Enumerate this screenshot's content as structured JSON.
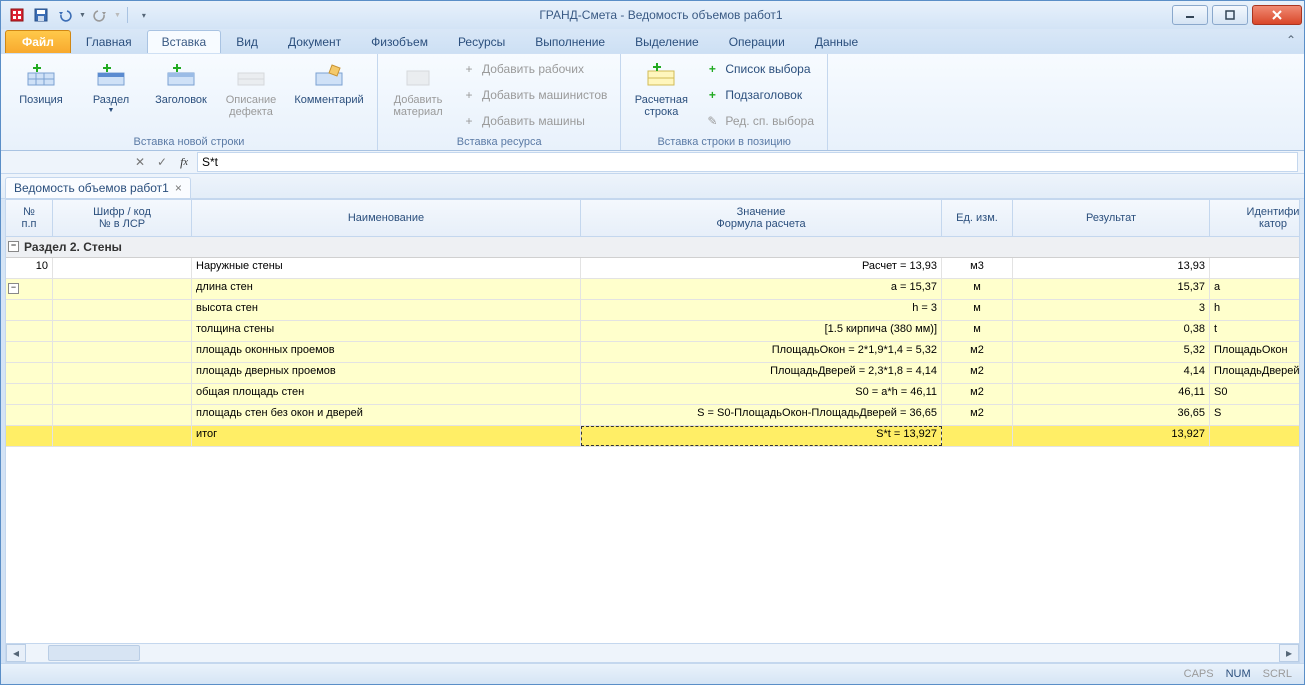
{
  "app_title": "ГРАНД-Смета - Ведомость объемов работ1",
  "tabs": {
    "file": "Файл",
    "items": [
      "Главная",
      "Вставка",
      "Вид",
      "Документ",
      "Физобъем",
      "Ресурсы",
      "Выполнение",
      "Выделение",
      "Операции",
      "Данные"
    ],
    "active": 1
  },
  "ribbon": {
    "g1": {
      "label": "Вставка новой строки",
      "position": "Позиция",
      "section": "Раздел",
      "header": "Заголовок",
      "defect": "Описание\nдефекта",
      "comment": "Комментарий"
    },
    "g2": {
      "label": "Вставка ресурса",
      "material": "Добавить\nматериал",
      "workers": "Добавить рабочих",
      "machinists": "Добавить машинистов",
      "machines": "Добавить машины"
    },
    "g3": {
      "label": "Вставка строки в позицию",
      "calcrow": "Расчетная\nстрока",
      "list": "Список выбора",
      "subhead": "Подзаголовок",
      "edit": "Ред. сп. выбора"
    }
  },
  "formula": {
    "value": "S*t"
  },
  "doc_tab": "Ведомость объемов работ1",
  "columns": {
    "np": "№\nп.п",
    "code": "Шифр / код\n№ в ЛСР",
    "name": "Наименование",
    "val": "Значение\nФормула расчета",
    "unit": "Ед. изм.",
    "res": "Результат",
    "id": "Идентифи\nкатор"
  },
  "section_title": "Раздел 2. Стены",
  "rows": [
    {
      "np": "10",
      "name": "Наружные стены",
      "val": "Расчет = 13,93",
      "unit": "м3",
      "res": "13,93",
      "ident": "",
      "variant": "plain"
    },
    {
      "np": "",
      "name": "длина стен",
      "val": "a = 15,37",
      "unit": "м",
      "res": "15,37",
      "ident": "a",
      "variant": "yellow"
    },
    {
      "np": "",
      "name": "высота стен",
      "val": "h = 3",
      "unit": "м",
      "res": "3",
      "ident": "h",
      "variant": "yellow"
    },
    {
      "np": "",
      "name": "толщина стены",
      "val": "[1.5 кирпича (380 мм)]",
      "unit": "м",
      "res": "0,38",
      "ident": "t",
      "variant": "yellow"
    },
    {
      "np": "",
      "name": "площадь оконных проемов",
      "val": "ПлощадьОкон = 2*1,9*1,4 = 5,32",
      "unit": "м2",
      "res": "5,32",
      "ident": "ПлощадьОкон",
      "variant": "yellow"
    },
    {
      "np": "",
      "name": "площадь дверных проемов",
      "val": "ПлощадьДверей = 2,3*1,8 = 4,14",
      "unit": "м2",
      "res": "4,14",
      "ident": "ПлощадьДверей",
      "variant": "yellow"
    },
    {
      "np": "",
      "name": "общая площадь стен",
      "val": "S0 = a*h = 46,11",
      "unit": "м2",
      "res": "46,11",
      "ident": "S0",
      "variant": "yellow"
    },
    {
      "np": "",
      "name": "площадь стен без окон и дверей",
      "val": "S = S0-ПлощадьОкон-ПлощадьДверей = 36,65",
      "unit": "м2",
      "res": "36,65",
      "ident": "S",
      "variant": "yellow"
    },
    {
      "np": "",
      "name": "итог",
      "val": "S*t = 13,927",
      "unit": "",
      "res": "13,927",
      "ident": "",
      "variant": "selected"
    }
  ],
  "status": {
    "caps": "CAPS",
    "num": "NUM",
    "scrl": "SCRL"
  }
}
